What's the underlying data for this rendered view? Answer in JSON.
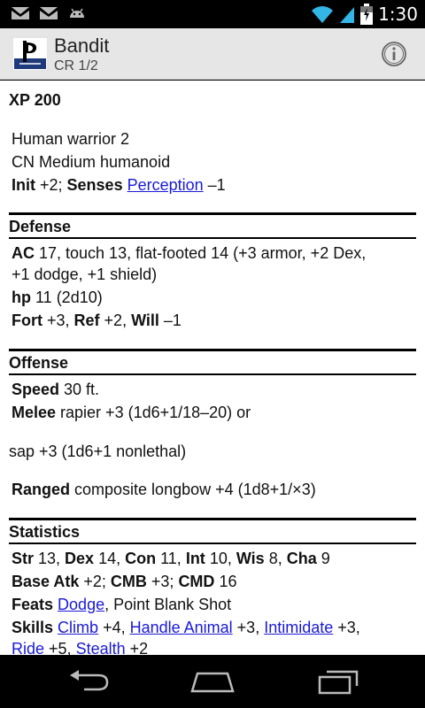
{
  "status_bar": {
    "time": "1:30",
    "icons": [
      "gmail-icon",
      "gmail-icon",
      "android-icon",
      "wifi-icon",
      "signal-icon",
      "battery-icon"
    ]
  },
  "action_bar": {
    "title": "Bandit",
    "subtitle": "CR 1/2"
  },
  "stat_block": {
    "xp": "XP 200",
    "race_class": "Human warrior 2",
    "type": "CN Medium humanoid",
    "init_label": "Init",
    "init_value": " +2; ",
    "senses_label": "Senses",
    "senses_link": "Perception",
    "senses_value": " –1",
    "defense": {
      "title": "Defense",
      "ac_label": "AC",
      "ac_line1": " 17, touch 13, flat-footed 14 (+3 armor, +2 Dex,",
      "ac_line2": "+1 dodge, +1 shield)",
      "hp_label": "hp",
      "hp_value": " 11 (2d10)",
      "fort_label": "Fort",
      "fort_value": " +3, ",
      "ref_label": "Ref",
      "ref_value": " +2, ",
      "will_label": "Will",
      "will_value": " –1"
    },
    "offense": {
      "title": "Offense",
      "speed_label": "Speed",
      "speed_value": " 30 ft.",
      "melee_label": "Melee",
      "melee_value": " rapier +3 (1d6+1/18–20) or",
      "melee_alt": "sap +3 (1d6+1 nonlethal)",
      "ranged_label": "Ranged",
      "ranged_value": " composite longbow +4 (1d8+1/×3)"
    },
    "statistics": {
      "title": "Statistics",
      "str_label": "Str",
      "str_value": " 13, ",
      "dex_label": "Dex",
      "dex_value": " 14, ",
      "con_label": "Con",
      "con_value": " 11, ",
      "int_label": "Int",
      "int_value": " 10, ",
      "wis_label": "Wis",
      "wis_value": " 8, ",
      "cha_label": "Cha",
      "cha_value": " 9",
      "bab_label": "Base Atk",
      "bab_value": " +2; ",
      "cmb_label": "CMB",
      "cmb_value": " +3; ",
      "cmd_label": "CMD",
      "cmd_value": " 16",
      "feats_label": "Feats",
      "feat_dodge": "Dodge",
      "feats_rest": ", Point Blank Shot",
      "skills_label": "Skills",
      "skill_climb": "Climb",
      "skill_climb_value": " +4, ",
      "skill_handle": "Handle Animal",
      "skill_handle_value": " +3, ",
      "skill_intimidate": "Intimidate",
      "skill_intimidate_value": " +3,",
      "skill_ride": "Ride",
      "skill_ride_value": " +5, ",
      "skill_stealth": "Stealth",
      "skill_stealth_value": " +2"
    }
  },
  "colors": {
    "link": "#1a1ad6",
    "action_bar_bg": "#e6e6e6",
    "status_accent": "#33b5e5"
  }
}
